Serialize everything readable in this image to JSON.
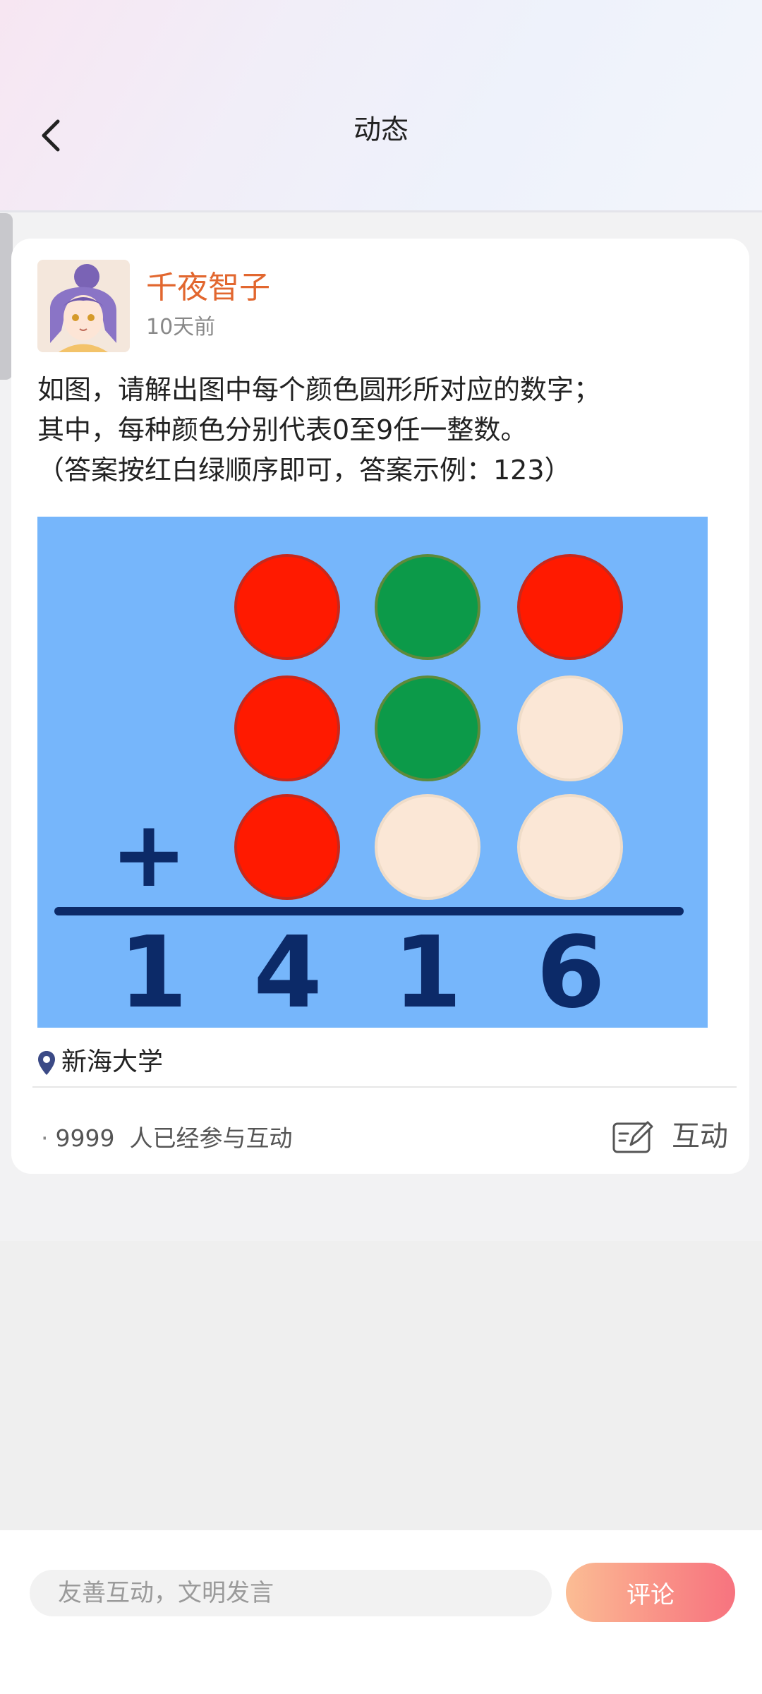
{
  "header": {
    "title": "动态"
  },
  "post": {
    "author": "千夜智子",
    "time_ago": "10天前",
    "text_lines": [
      "如图，请解出图中每个颜色圆形所对应的数字；",
      "其中，每种颜色分别代表0至9任一整数。",
      "（答案按红白绿顺序即可，答案示例：123）"
    ],
    "puzzle": {
      "operator": "+",
      "rows": [
        [
          "red",
          "green",
          "red"
        ],
        [
          "red",
          "green",
          "white"
        ],
        [
          "red",
          "white",
          "white"
        ]
      ],
      "result_digits": [
        "1",
        "4",
        "1",
        "6"
      ],
      "colors": {
        "background": "#76b6fb",
        "red": "#ff1a00",
        "green": "#0c9a49",
        "white": "#fbe7d6",
        "ink": "#0c2a68"
      }
    },
    "location": "新海大学",
    "participants": {
      "count": "9999",
      "suffix": "人已经参与互动"
    },
    "interact_label": "互动"
  },
  "comment_bar": {
    "placeholder": "友善互动，文明发言",
    "submit_label": "评论"
  },
  "icons": {
    "back": "chevron-left-icon",
    "location": "location-pin-icon",
    "interact": "edit-note-icon"
  }
}
